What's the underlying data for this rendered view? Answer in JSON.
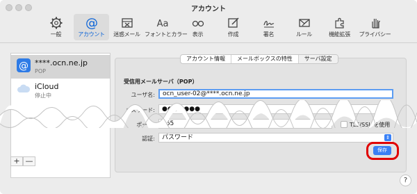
{
  "window": {
    "title": "アカウント"
  },
  "toolbar": {
    "items": [
      {
        "label": "一般",
        "icon": "gear-icon"
      },
      {
        "label": "アカウント",
        "icon": "at-icon",
        "active": true
      },
      {
        "label": "迷惑メール",
        "icon": "junk-tray-icon"
      },
      {
        "label": "フォントとカラー",
        "icon": "font-icon"
      },
      {
        "label": "表示",
        "icon": "glasses-icon"
      },
      {
        "label": "作成",
        "icon": "compose-icon"
      },
      {
        "label": "署名",
        "icon": "signature-icon"
      },
      {
        "label": "ルール",
        "icon": "rules-icon"
      },
      {
        "label": "機能拡張",
        "icon": "puzzle-icon"
      },
      {
        "label": "プライバシー",
        "icon": "hand-icon"
      }
    ]
  },
  "sidebar": {
    "accounts": [
      {
        "name": "****.ocn.ne.jp",
        "sub": "POP",
        "icon": "at-icon",
        "selected": true
      },
      {
        "name": "iCloud",
        "sub": "停止中",
        "icon": "cloud-icon"
      }
    ],
    "add_label": "+",
    "remove_label": "—"
  },
  "tabs": [
    {
      "label": "アカウント情報"
    },
    {
      "label": "メールボックスの特性"
    },
    {
      "label": "サーバ設定",
      "active": true
    }
  ],
  "form": {
    "section_title": "受信用メールサーバ（POP）",
    "username_label": "ユーザ名:",
    "username_value": "ocn_user-02@****.ocn.ne.jp",
    "password_label": "パスワード:",
    "password_value": "●●●●●●●",
    "port_label": "ポート:",
    "port_value": "465",
    "tls_label": "TLS/SSL を使用",
    "auth_label": "認証:",
    "auth_value": "パスワード"
  },
  "save_label": "保存",
  "help_label": "?",
  "colors": {
    "accent": "#3a7ff4",
    "highlight": "#e00000"
  }
}
